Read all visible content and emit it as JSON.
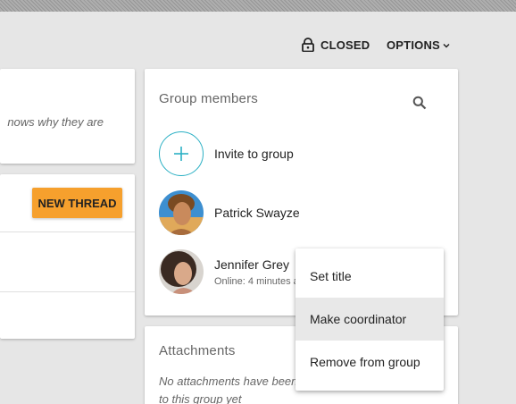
{
  "topbar": {
    "closed_label": "CLOSED",
    "options_label": "OPTIONS"
  },
  "left_cards": {
    "description_fragment": "nows why they are",
    "new_thread_label": "NEW THREAD"
  },
  "members": {
    "title": "Group members",
    "invite_label": "Invite to group",
    "list": [
      {
        "name": "Patrick Swayze",
        "status": ""
      },
      {
        "name": "Jennifer Grey",
        "status": "Online: 4 minutes ago"
      }
    ]
  },
  "attachments": {
    "title": "Attachments",
    "empty_text": "No attachments have been added to this group yet"
  },
  "context_menu": {
    "items": [
      "Set title",
      "Make coordinator",
      "Remove from group"
    ],
    "active_index": 1
  },
  "colors": {
    "accent_teal": "#2bb0c4",
    "new_thread_orange": "#f6a02d",
    "background": "#e6e6e6"
  }
}
